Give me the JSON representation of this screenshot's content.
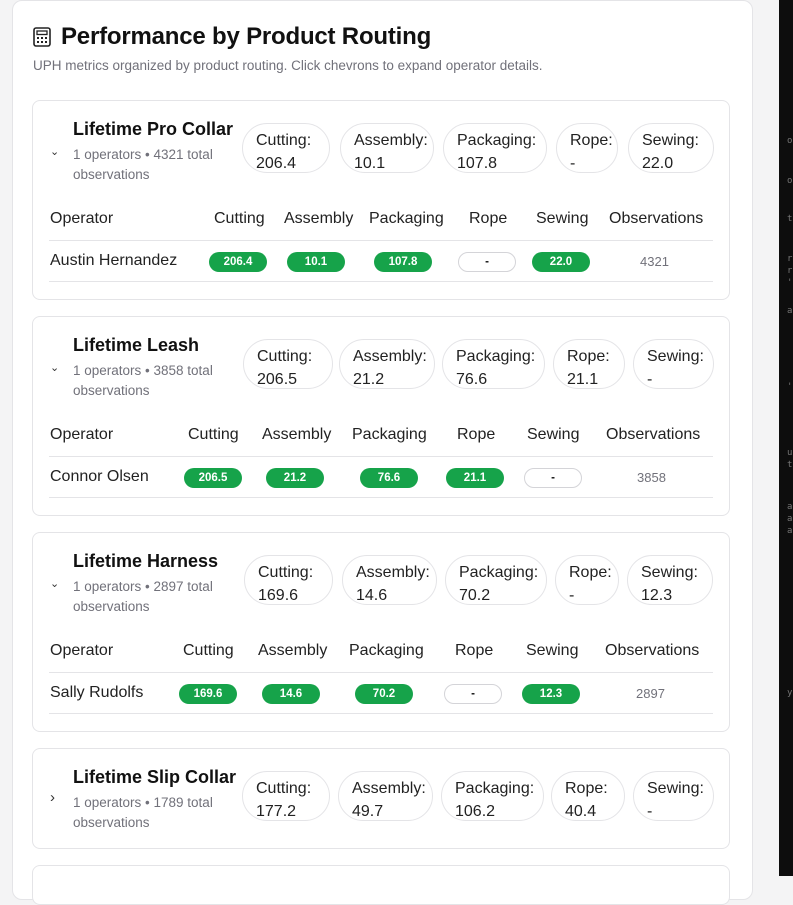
{
  "header": {
    "title": "Performance by Product Routing",
    "subtitle": "UPH metrics organized by product routing. Click chevrons to expand operator details.",
    "icon": "calculator-icon"
  },
  "table_headers": {
    "operator": "Operator",
    "cutting": "Cutting",
    "assembly": "Assembly",
    "packaging": "Packaging",
    "rope": "Rope",
    "sewing": "Sewing",
    "observations": "Observations"
  },
  "groups": [
    {
      "product": "Lifetime Pro Collar",
      "meta": "1 operators • 4321 total observations",
      "expanded": true,
      "chevron": "⌄",
      "metrics": [
        {
          "label": "Cutting:",
          "value": "206.4"
        },
        {
          "label": "Assembly:",
          "value": "10.1"
        },
        {
          "label": "Packaging:",
          "value": "107.8"
        },
        {
          "label": "Rope:",
          "value": "-"
        },
        {
          "label": "Sewing:",
          "value": "22.0"
        }
      ],
      "operators": [
        {
          "name": "Austin Hernandez",
          "cutting": "206.4",
          "assembly": "10.1",
          "packaging": "107.8",
          "rope": "-",
          "sewing": "22.0",
          "observations": "4321"
        }
      ]
    },
    {
      "product": "Lifetime Leash",
      "meta": "1 operators • 3858 total observations",
      "expanded": true,
      "chevron": "⌄",
      "metrics": [
        {
          "label": "Cutting:",
          "value": "206.5"
        },
        {
          "label": "Assembly:",
          "value": "21.2"
        },
        {
          "label": "Packaging:",
          "value": "76.6"
        },
        {
          "label": "Rope:",
          "value": "21.1"
        },
        {
          "label": "Sewing:",
          "value": "-"
        }
      ],
      "operators": [
        {
          "name": "Connor Olsen",
          "cutting": "206.5",
          "assembly": "21.2",
          "packaging": "76.6",
          "rope": "21.1",
          "sewing": "-",
          "observations": "3858"
        }
      ]
    },
    {
      "product": "Lifetime Harness",
      "meta": "1 operators • 2897 total observations",
      "expanded": true,
      "chevron": "⌄",
      "metrics": [
        {
          "label": "Cutting:",
          "value": "169.6"
        },
        {
          "label": "Assembly:",
          "value": "14.6"
        },
        {
          "label": "Packaging:",
          "value": "70.2"
        },
        {
          "label": "Rope:",
          "value": "-"
        },
        {
          "label": "Sewing:",
          "value": "12.3"
        }
      ],
      "operators": [
        {
          "name": "Sally Rudolfs",
          "cutting": "169.6",
          "assembly": "14.6",
          "packaging": "70.2",
          "rope": "-",
          "sewing": "12.3",
          "observations": "2897"
        }
      ]
    },
    {
      "product": "Lifetime Slip Collar",
      "meta": "1 operators • 1789 total observations",
      "expanded": false,
      "chevron": "›",
      "metrics": [
        {
          "label": "Cutting:",
          "value": "177.2"
        },
        {
          "label": "Assembly:",
          "value": "49.7"
        },
        {
          "label": "Packaging:",
          "value": "106.2"
        },
        {
          "label": "Rope:",
          "value": "40.4"
        },
        {
          "label": "Sewing:",
          "value": "-"
        }
      ],
      "operators": []
    }
  ],
  "colors": {
    "badge_green": "#16a34a",
    "border": "#e4e4e7",
    "muted_text": "#71717a"
  }
}
